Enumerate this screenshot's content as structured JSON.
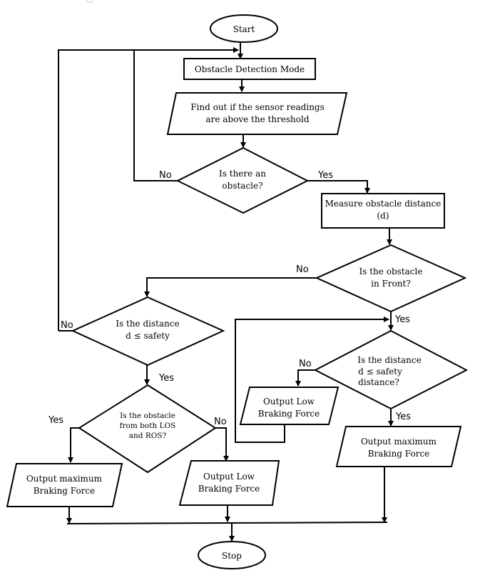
{
  "diagram": {
    "type": "flowchart",
    "colors": {
      "stroke": "#000000",
      "background": "#ffffff"
    },
    "nodes": {
      "start": {
        "shape": "terminator",
        "text": [
          "Start"
        ]
      },
      "detection_mode": {
        "shape": "process",
        "text": [
          "Obstacle Detection Mode"
        ]
      },
      "sensor_check": {
        "shape": "data",
        "text": [
          "Find out if the sensor readings",
          "are above the threshold"
        ]
      },
      "is_obstacle": {
        "shape": "decision",
        "text": [
          "Is there an",
          "obstacle?"
        ]
      },
      "measure_distance": {
        "shape": "process",
        "text": [
          "Measure obstacle distance",
          "(d)"
        ]
      },
      "in_front": {
        "shape": "decision",
        "text": [
          "Is the obstacle",
          "in Front?"
        ]
      },
      "side_distance": {
        "shape": "decision",
        "text": [
          "Is the distance",
          "d ≤ safety"
        ]
      },
      "both_sides": {
        "shape": "decision",
        "text": [
          "Is the obstacle",
          "from both LOS",
          "and ROS?"
        ]
      },
      "side_max_force": {
        "shape": "data",
        "text": [
          "Output maximum",
          "Braking Force"
        ]
      },
      "side_low_force": {
        "shape": "data",
        "text": [
          "Output Low",
          "Braking Force"
        ]
      },
      "front_distance": {
        "shape": "decision",
        "text": [
          "Is the distance",
          "d ≤ safety",
          "distance?"
        ]
      },
      "front_low_force": {
        "shape": "data",
        "text": [
          "Output Low",
          "Braking Force"
        ]
      },
      "front_max_force": {
        "shape": "data",
        "text": [
          "Output maximum",
          "Braking Force"
        ]
      },
      "stop": {
        "shape": "terminator",
        "text": [
          "Stop"
        ]
      }
    },
    "edge_labels": {
      "obstacle_no": "No",
      "obstacle_yes": "Yes",
      "front_no": "No",
      "front_yes": "Yes",
      "side_distance_no": "No",
      "side_distance_yes": "Yes",
      "both_yes": "Yes",
      "both_no": "No",
      "front_distance_no": "No",
      "front_distance_yes": "Yes"
    },
    "edges": [
      {
        "from": "start",
        "to": "detection_mode"
      },
      {
        "from": "detection_mode",
        "to": "sensor_check"
      },
      {
        "from": "sensor_check",
        "to": "is_obstacle"
      },
      {
        "from": "is_obstacle",
        "to": "detection_mode",
        "label": "No"
      },
      {
        "from": "is_obstacle",
        "to": "measure_distance",
        "label": "Yes"
      },
      {
        "from": "measure_distance",
        "to": "in_front"
      },
      {
        "from": "in_front",
        "to": "side_distance",
        "label": "No"
      },
      {
        "from": "in_front",
        "to": "front_distance",
        "label": "Yes"
      },
      {
        "from": "side_distance",
        "to": "detection_mode",
        "label": "No"
      },
      {
        "from": "side_distance",
        "to": "both_sides",
        "label": "Yes"
      },
      {
        "from": "both_sides",
        "to": "side_max_force",
        "label": "Yes"
      },
      {
        "from": "both_sides",
        "to": "side_low_force",
        "label": "No"
      },
      {
        "from": "front_distance",
        "to": "front_low_force",
        "label": "No"
      },
      {
        "from": "front_distance",
        "to": "front_max_force",
        "label": "Yes"
      },
      {
        "from": "front_low_force",
        "to": "front_distance"
      },
      {
        "from": "side_max_force",
        "to": "stop"
      },
      {
        "from": "side_low_force",
        "to": "stop"
      },
      {
        "from": "front_max_force",
        "to": "stop"
      }
    ]
  }
}
